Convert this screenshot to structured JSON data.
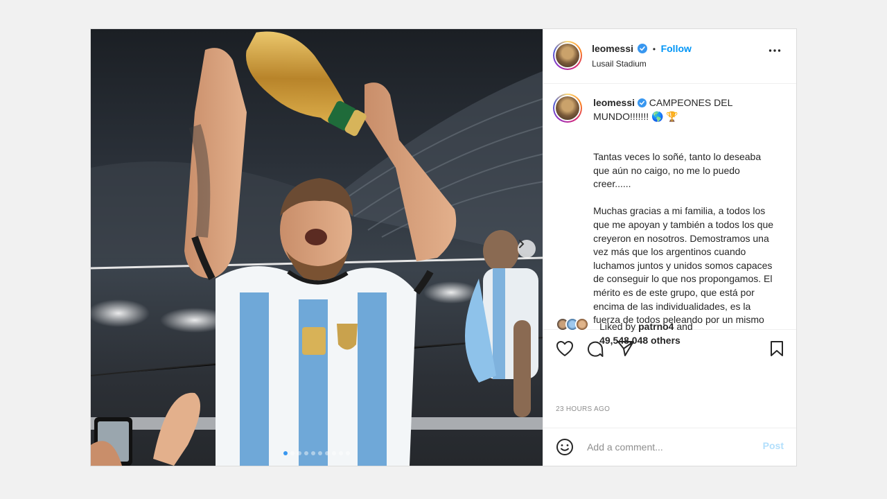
{
  "post": {
    "username": "leomessi",
    "location": "Lusail Stadium",
    "follow_label": "Follow",
    "separator": "•",
    "caption_first": "CAMPEONES DEL MUNDO!!!!!!! 🌎 🏆",
    "caption_body": "Tantas veces lo soñé, tanto lo deseaba que aún no caigo, no me lo puedo creer......\n\nMuchas gracias a mi familia, a todos los que me apoyan y también a todos los que creyeron en nosotros. Demostramos una vez más que los argentinos cuando luchamos juntos y unidos somos capaces de conseguir lo que nos propongamos. El mérito es de este grupo, que está por encima de las individualidades, es la fuerza de todos peleando por un mismo sueño",
    "liked_prefix": "Liked by",
    "liked_user": "patrno4",
    "liked_and": "and",
    "liked_others": "49,548,048 others",
    "time": "23 HOURS AGO",
    "comment_placeholder": "Add a comment...",
    "post_label": "Post"
  },
  "carousel": {
    "count": 10,
    "active": 0
  },
  "colors": {
    "accent": "#0095f6",
    "verified": "#3897f0",
    "post_disabled": "#b2dffc"
  },
  "icons": [
    "verified-badge-icon",
    "more-options-icon",
    "heart-icon",
    "comment-icon",
    "share-icon",
    "bookmark-icon",
    "emoji-icon",
    "chevron-right-icon"
  ]
}
